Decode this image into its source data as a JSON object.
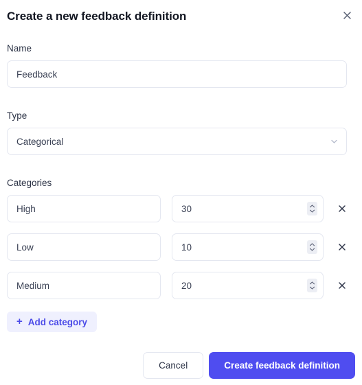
{
  "dialog": {
    "title": "Create a new feedback definition",
    "close_icon": "close-icon"
  },
  "name_field": {
    "label": "Name",
    "value": "Feedback",
    "placeholder": "Name"
  },
  "type_field": {
    "label": "Type",
    "value": "Categorical",
    "chevron_icon": "chevron-down-icon"
  },
  "categories_section": {
    "label": "Categories",
    "rows": [
      {
        "name": "High",
        "value": "30",
        "remove_icon": "close-icon"
      },
      {
        "name": "Low",
        "value": "10",
        "remove_icon": "close-icon"
      },
      {
        "name": "Medium",
        "value": "20",
        "remove_icon": "close-icon"
      }
    ],
    "add_button": {
      "label": "Add category",
      "icon": "plus-icon",
      "plus_glyph": "+"
    }
  },
  "footer": {
    "cancel_label": "Cancel",
    "submit_label": "Create feedback definition"
  },
  "colors": {
    "primary": "#4f4df0",
    "primary_soft_bg": "#eff0fe",
    "primary_text": "#4c4ce8",
    "border": "#e4e7f0",
    "title_text": "#131722",
    "label_text": "#2c3346",
    "input_text": "#3a4154",
    "spinner_bg": "#eceef4"
  }
}
